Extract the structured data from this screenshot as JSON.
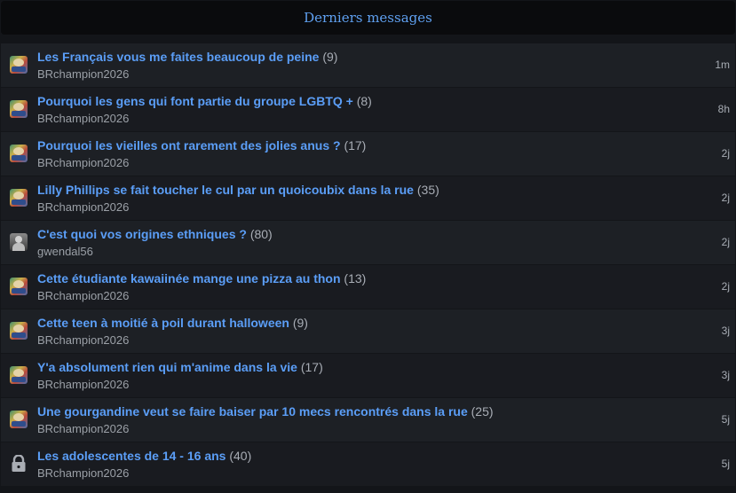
{
  "header": {
    "title": "Derniers messages"
  },
  "topics": [
    {
      "title": "Les Français vous me faites beaucoup de peine",
      "count": "(9)",
      "author": "BRchampion2026",
      "time": "1m",
      "icon": "user-avatar-icon"
    },
    {
      "title": "Pourquoi les gens qui font partie du groupe LGBTQ +",
      "count": "(8)",
      "author": "BRchampion2026",
      "time": "8h",
      "icon": "user-avatar-icon"
    },
    {
      "title": "Pourquoi les vieilles ont rarement des jolies anus ?",
      "count": "(17)",
      "author": "BRchampion2026",
      "time": "2j",
      "icon": "user-avatar-icon"
    },
    {
      "title": "Lilly Phillips se fait toucher le cul par un quoicoubix dans la rue",
      "count": "(35)",
      "author": "BRchampion2026",
      "time": "2j",
      "icon": "user-avatar-icon"
    },
    {
      "title": "C'est quoi vos origines ethniques ?",
      "count": "(80)",
      "author": "gwendal56",
      "time": "2j",
      "icon": "user-avatar-icon"
    },
    {
      "title": "Cette étudiante kawaiinée mange une pizza au thon",
      "count": "(13)",
      "author": "BRchampion2026",
      "time": "2j",
      "icon": "user-avatar-icon"
    },
    {
      "title": "Cette teen à moitié à poil durant halloween",
      "count": "(9)",
      "author": "BRchampion2026",
      "time": "3j",
      "icon": "user-avatar-icon"
    },
    {
      "title": "Y'a absolument rien qui m'anime dans la vie",
      "count": "(17)",
      "author": "BRchampion2026",
      "time": "3j",
      "icon": "user-avatar-icon"
    },
    {
      "title": "Une gourgandine veut se faire baiser par 10 mecs rencontrés dans la rue",
      "count": "(25)",
      "author": "BRchampion2026",
      "time": "5j",
      "icon": "user-avatar-icon"
    },
    {
      "title": "Les adolescentes de 14 - 16 ans",
      "count": "(40)",
      "author": "BRchampion2026",
      "time": "5j",
      "icon": "lock-icon"
    }
  ]
}
